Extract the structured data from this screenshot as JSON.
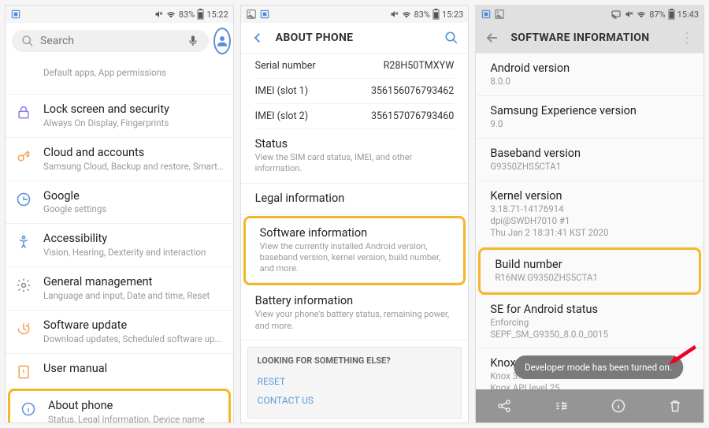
{
  "p1": {
    "status": {
      "battery": "83%",
      "time": "15:22"
    },
    "search": {
      "placeholder": "Search"
    },
    "items": [
      {
        "title": "",
        "sub": "Default apps, App permissions"
      },
      {
        "title": "Lock screen and security",
        "sub": "Always On Display, Fingerprints"
      },
      {
        "title": "Cloud and accounts",
        "sub": "Samsung Cloud, Backup and restore, Smart..."
      },
      {
        "title": "Google",
        "sub": "Google settings"
      },
      {
        "title": "Accessibility",
        "sub": "Vision, Hearing, Dexterity and interaction"
      },
      {
        "title": "General management",
        "sub": "Language and input, Date and time, Reset"
      },
      {
        "title": "Software update",
        "sub": "Download updates, Scheduled software up..."
      },
      {
        "title": "User manual",
        "sub": ""
      },
      {
        "title": "About phone",
        "sub": "Status, Legal information, Device name"
      }
    ]
  },
  "p2": {
    "status": {
      "battery": "83%",
      "time": "15:23"
    },
    "title": "ABOUT PHONE",
    "table": [
      {
        "k": "Serial number",
        "v": "R28H50TMXYW"
      },
      {
        "k": "IMEI (slot 1)",
        "v": "356156076793462"
      },
      {
        "k": "IMEI (slot 2)",
        "v": "356157076793460"
      }
    ],
    "status_section": {
      "title": "Status",
      "sub": "View the SIM card status, IMEI, and other information."
    },
    "legal": {
      "title": "Legal information"
    },
    "software": {
      "title": "Software information",
      "sub": "View the currently installed Android version, baseband version, kernel version, build number, and more."
    },
    "battery_info": {
      "title": "Battery information",
      "sub": "View your phone's battery status, remaining power, and more."
    },
    "footer": {
      "title": "LOOKING FOR SOMETHING ELSE?",
      "links": [
        "RESET",
        "CONTACT US"
      ]
    }
  },
  "p3": {
    "status": {
      "battery": "87%",
      "time": "15:43"
    },
    "title": "SOFTWARE INFORMATION",
    "items": [
      {
        "t": "Android version",
        "v": "8.0.0"
      },
      {
        "t": "Samsung Experience version",
        "v": "9.0"
      },
      {
        "t": "Baseband version",
        "v": "G9350ZHS5CTA1"
      },
      {
        "t": "Kernel version",
        "v": "3.18.71-14176914\ndpi@SWDH7010 #1\nThu Jan 2 18:31:41 KST 2020"
      },
      {
        "t": "Build number",
        "v": "R16NW.G9350ZHS5CTA1"
      },
      {
        "t": "SE for Android status",
        "v": "Enforcing\nSEPF_SM_G9350_8.0.0_0015"
      },
      {
        "t": "Knox version",
        "v": "Knox 3.1\nKnox API level 25"
      }
    ],
    "toast": "Developer mode has been turned on."
  }
}
